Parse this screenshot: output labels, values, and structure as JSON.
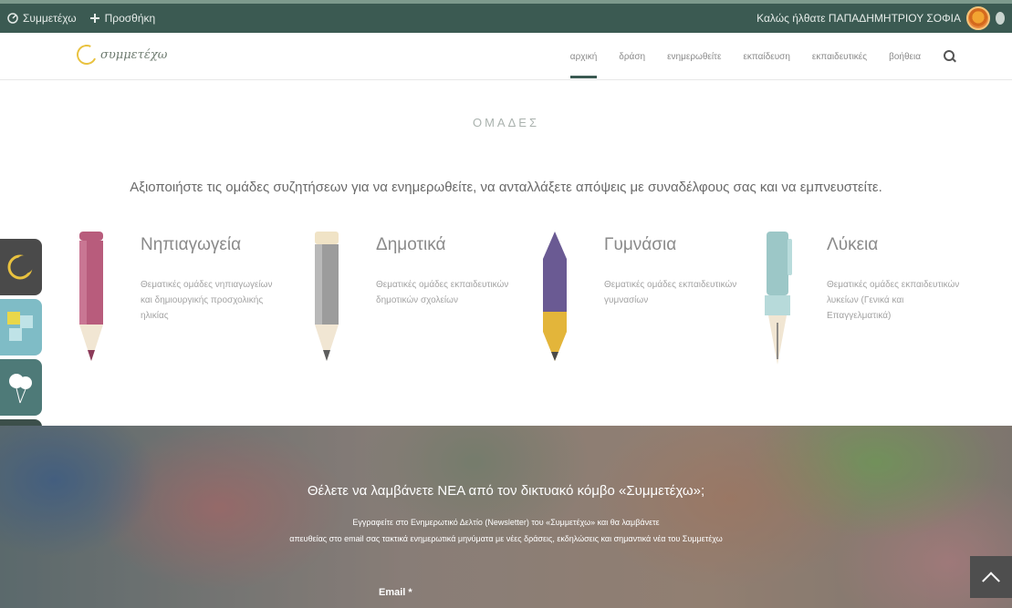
{
  "adminbar": {
    "items": [
      {
        "label": "Συμμετέχω",
        "icon": "dashboard-icon"
      },
      {
        "label": "Προσθήκη",
        "icon": "plus-icon"
      }
    ],
    "greeting": "Καλώς ήλθατε ΠΑΠΑΔΗΜΗΤΡΙΟΥ ΣΟΦΙΑ"
  },
  "header": {
    "logo_text": "συμμετέχω",
    "nav": [
      "αρχική",
      "δράση",
      "ενημερωθείτε",
      "εκπαίδευση",
      "εκπαιδευτικές",
      "βοήθεια"
    ]
  },
  "section": {
    "title": "ΟΜΑΔΕΣ",
    "intro": "Αξιοποιήστε τις ομάδες συζητήσεων για να ενημερωθείτε, να ανταλλάξετε απόψεις με συναδέλφους σας και να εμπνευστείτε."
  },
  "levels": [
    {
      "title": "Νηπιαγωγεία",
      "desc": "Θεματικές ομάδες νηπιαγωγείων και δημιουργικής προσχολικής ηλικίας",
      "colors": {
        "body": "#b85c7c",
        "tip": "#8c3b5a"
      }
    },
    {
      "title": "Δημοτικά",
      "desc": "Θεματικές ομάδες εκπαιδευτικών δημοτικών σχολείων",
      "colors": {
        "body": "#9c9c9c",
        "tip": "#5e5e5e"
      }
    },
    {
      "title": "Γυμνάσια",
      "desc": "Θεματικές ομάδες εκπαιδευτικών γυμνασίων",
      "colors": {
        "body": "#6a5a93",
        "tip": "#e3b53a"
      }
    },
    {
      "title": "Λύκεια",
      "desc": "Θεματικές ομάδες εκπαιδευτικών λυκείων (Γενικά και Επαγγελματικά)",
      "colors": {
        "body": "#9cc7c7",
        "tip": "#6e6e6e"
      }
    }
  ],
  "side_tab": {
    "items": [
      {
        "icon": "moon-logo-icon",
        "color": "#4a4a4a"
      },
      {
        "icon": "puzzle-icon",
        "color": "#7fbcc6"
      },
      {
        "icon": "balloons-icon",
        "color": "#4e7a78"
      },
      {
        "icon": "sign-icon",
        "color": "#3c4f4a"
      }
    ]
  },
  "hero": {
    "title": "Θέλετε να λαμβάνετε ΝΕΑ από τον δικτυακό κόμβο «Συμμετέχω»;",
    "line1": "Εγγραφείτε στο Ενημερωτικό Δελτίο (Newsletter) του «Συμμετέχω» και θα λαμβάνετε",
    "line2": "απευθείας στο email σας τακτικά ενημερωτικά μηνύματα με νέες δράσεις, εκδηλώσεις και σημαντικά νέα του Συμμετέχω",
    "email_label": "Email *"
  }
}
